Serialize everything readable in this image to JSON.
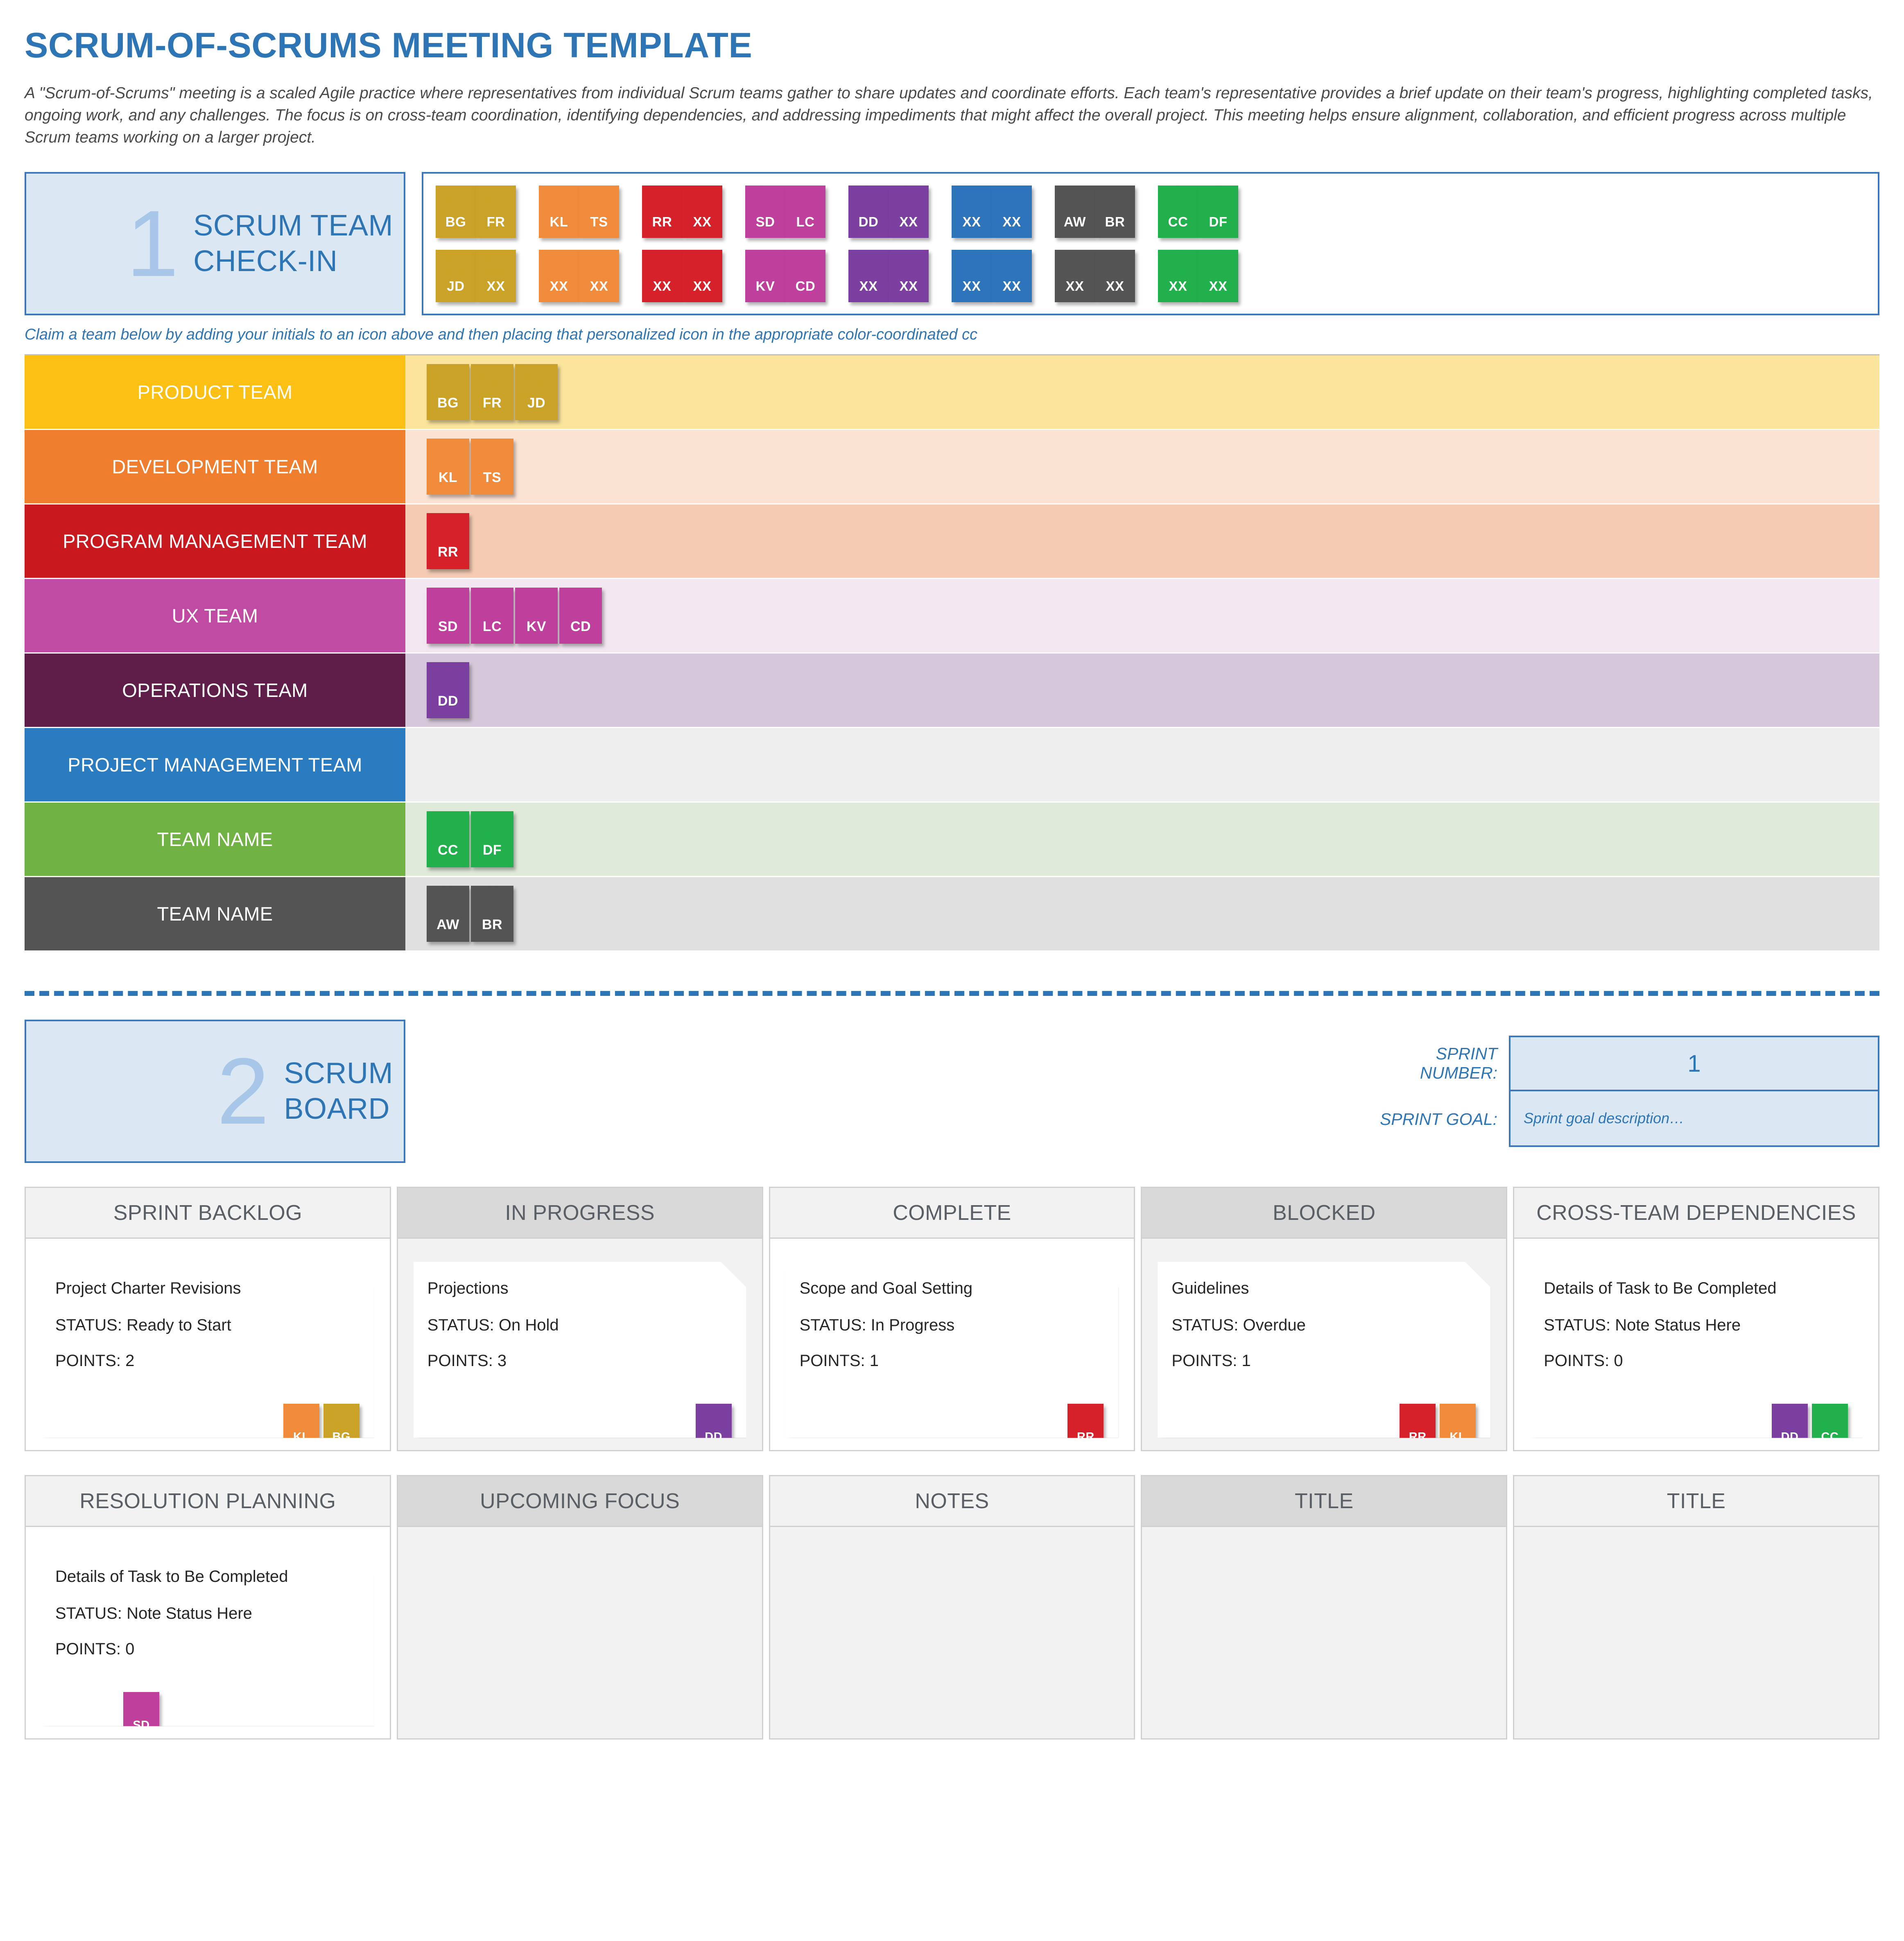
{
  "document": {
    "title": "SCRUM-OF-SCRUMS MEETING TEMPLATE",
    "description": "A \"Scrum-of-Scrums\" meeting is a scaled Agile practice where representatives from individual Scrum teams gather to share updates and coordinate efforts. Each team's representative provides a brief update on their team's progress, highlighting completed tasks, ongoing work, and any challenges. The focus is on cross-team coordination, identifying dependencies, and addressing impediments that might affect the overall project. This meeting helps ensure alignment, collaboration, and efficient progress across multiple Scrum teams working on a larger project."
  },
  "section1": {
    "number": "1",
    "title_line1": "SCRUM TEAM",
    "title_line2": "CHECK-IN",
    "hint": "Claim a team below by adding your initials to an icon above and then placing that personalized icon in the appropriate color-coordinated cc",
    "palette": {
      "row1": [
        {
          "initials": "BG",
          "color": "gold"
        },
        {
          "initials": "FR",
          "color": "gold"
        },
        {
          "initials": "KL",
          "color": "orange"
        },
        {
          "initials": "TS",
          "color": "orange"
        },
        {
          "initials": "RR",
          "color": "red"
        },
        {
          "initials": "XX",
          "color": "red"
        },
        {
          "initials": "SD",
          "color": "pink"
        },
        {
          "initials": "LC",
          "color": "pink"
        },
        {
          "initials": "DD",
          "color": "purple"
        },
        {
          "initials": "XX",
          "color": "purple"
        },
        {
          "initials": "XX",
          "color": "blue"
        },
        {
          "initials": "XX",
          "color": "blue"
        },
        {
          "initials": "AW",
          "color": "gray"
        },
        {
          "initials": "BR",
          "color": "gray"
        },
        {
          "initials": "CC",
          "color": "green"
        },
        {
          "initials": "DF",
          "color": "green"
        }
      ],
      "row2": [
        {
          "initials": "JD",
          "color": "gold"
        },
        {
          "initials": "XX",
          "color": "gold"
        },
        {
          "initials": "XX",
          "color": "orange"
        },
        {
          "initials": "XX",
          "color": "orange"
        },
        {
          "initials": "XX",
          "color": "red"
        },
        {
          "initials": "XX",
          "color": "red"
        },
        {
          "initials": "KV",
          "color": "pink"
        },
        {
          "initials": "CD",
          "color": "pink"
        },
        {
          "initials": "XX",
          "color": "purple"
        },
        {
          "initials": "XX",
          "color": "purple"
        },
        {
          "initials": "XX",
          "color": "blue"
        },
        {
          "initials": "XX",
          "color": "blue"
        },
        {
          "initials": "XX",
          "color": "gray"
        },
        {
          "initials": "XX",
          "color": "gray"
        },
        {
          "initials": "XX",
          "color": "green"
        },
        {
          "initials": "XX",
          "color": "green"
        }
      ]
    },
    "teams": [
      {
        "name": "PRODUCT TEAM",
        "bar": "bar-gold",
        "tint": "tint-gold",
        "icon": "c-gold",
        "members": [
          "BG",
          "FR",
          "JD"
        ]
      },
      {
        "name": "DEVELOPMENT TEAM",
        "bar": "bar-orange",
        "tint": "tint-orange",
        "icon": "c-orange",
        "members": [
          "KL",
          "TS"
        ]
      },
      {
        "name": "PROGRAM MANAGEMENT TEAM",
        "bar": "bar-red",
        "tint": "tint-red",
        "icon": "c-red",
        "members": [
          "RR"
        ]
      },
      {
        "name": "UX TEAM",
        "bar": "bar-pink",
        "tint": "tint-pink",
        "icon": "c-pink",
        "members": [
          "SD",
          "LC",
          "KV",
          "CD"
        ]
      },
      {
        "name": "OPERATIONS TEAM",
        "bar": "bar-plum",
        "tint": "tint-plum",
        "icon": "c-purple",
        "members": [
          "DD"
        ]
      },
      {
        "name": "PROJECT MANAGEMENT TEAM",
        "bar": "bar-blue",
        "tint": "tint-blue",
        "icon": "c-blue",
        "members": []
      },
      {
        "name": "TEAM NAME",
        "bar": "bar-green",
        "tint": "tint-green",
        "icon": "c-green",
        "members": [
          "CC",
          "DF"
        ]
      },
      {
        "name": "TEAM NAME",
        "bar": "bar-gray",
        "tint": "tint-gray",
        "icon": "c-gray",
        "members": [
          "AW",
          "BR"
        ]
      }
    ]
  },
  "section2": {
    "number": "2",
    "title_line1": "SCRUM",
    "title_line2": "BOARD",
    "sprint_number_label": "SPRINT NUMBER:",
    "sprint_number_value": "1",
    "sprint_goal_label": "SPRINT GOAL:",
    "sprint_goal_value": "Sprint goal description…",
    "board_top": [
      {
        "header": "SPRINT BACKLOG",
        "shade": "light",
        "card": {
          "title": "Project Charter Revisions",
          "status": "STATUS: Ready to Start",
          "points": "POINTS: 2",
          "avatars": [
            {
              "initials": "KL",
              "color": "c-orange"
            },
            {
              "initials": "BG",
              "color": "c-gold"
            }
          ]
        }
      },
      {
        "header": "IN PROGRESS",
        "shade": "dark",
        "card": {
          "title": "Projections",
          "status": "STATUS: On Hold",
          "points": "POINTS: 3",
          "avatars": [
            {
              "initials": "DD",
              "color": "c-purple"
            }
          ]
        }
      },
      {
        "header": "COMPLETE",
        "shade": "light",
        "card": {
          "title": "Scope and Goal Setting",
          "status": "STATUS: In Progress",
          "points": "POINTS: 1",
          "avatars": [
            {
              "initials": "RR",
              "color": "c-red"
            }
          ]
        }
      },
      {
        "header": "BLOCKED",
        "shade": "dark",
        "card": {
          "title": "Guidelines",
          "status": "STATUS: Overdue",
          "points": "POINTS: 1",
          "avatars": [
            {
              "initials": "RR",
              "color": "c-red"
            },
            {
              "initials": "KL",
              "color": "c-orange"
            }
          ]
        }
      },
      {
        "header": "CROSS-TEAM DEPENDENCIES",
        "shade": "light",
        "card": {
          "title": "Details of Task to Be Completed",
          "status": "STATUS: Note Status Here",
          "points": "POINTS: 0",
          "avatars": [
            {
              "initials": "DD",
              "color": "c-purple"
            },
            {
              "initials": "CC",
              "color": "c-green"
            }
          ]
        }
      }
    ],
    "board_bottom": [
      {
        "header": "RESOLUTION PLANNING",
        "shade": "light",
        "card": {
          "title": "Details of Task to Be Completed",
          "status": "STATUS: Note Status Here",
          "points": "POINTS: 0",
          "avatars": [
            {
              "initials": "SD",
              "color": "c-pink"
            }
          ]
        }
      },
      {
        "header": "UPCOMING FOCUS",
        "shade": "dark",
        "card": null
      },
      {
        "header": "NOTES",
        "shade": "light",
        "card": null
      },
      {
        "header": "TITLE",
        "shade": "dark",
        "card": null
      },
      {
        "header": "TITLE",
        "shade": "light",
        "card": null
      }
    ]
  },
  "colors": {
    "brand_blue": "#2e75b6",
    "badge_fill": "#dce7f4",
    "gold": "#c9a227",
    "orange": "#f18b3c",
    "red": "#d6212a",
    "pink": "#bf3f9c",
    "purple": "#7b3fa0",
    "blue": "#2d74ba",
    "green": "#21b04b",
    "gray": "#545454"
  }
}
